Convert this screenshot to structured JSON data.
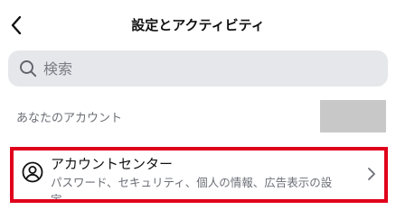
{
  "header": {
    "title": "設定とアクティビティ",
    "back_icon": "chevron-left-icon"
  },
  "search": {
    "placeholder": "検索",
    "icon": "search-icon"
  },
  "section": {
    "label": "あなたのアカウント"
  },
  "account_center": {
    "title": "アカウントセンター",
    "subtitle": "パスワード、セキュリティ、個人の情報、広告表示の設定",
    "icon": "person-circle-icon",
    "chevron_icon": "chevron-right-icon",
    "highlight_color": "#e0001b"
  }
}
